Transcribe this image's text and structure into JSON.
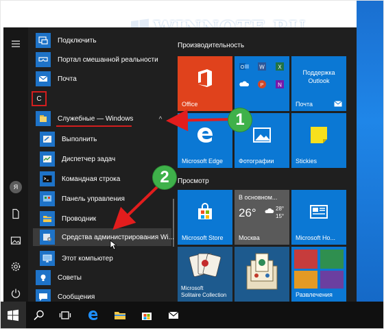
{
  "watermark": {
    "text": "WINNOTE.RU"
  },
  "rail": {
    "icons": [
      "hamburger-icon",
      "user-icon",
      "document-icon",
      "pictures-icon",
      "settings-icon",
      "power-icon"
    ],
    "avatar_letter": "Я"
  },
  "app_list": {
    "items": [
      {
        "label": "Подключить",
        "icon": "connect-icon"
      },
      {
        "label": "Портал смешанной реальности",
        "icon": "mixed-reality-icon"
      },
      {
        "label": "Почта",
        "icon": "mail-icon"
      },
      {
        "label": "Служебные — Windows",
        "icon": "folder-icon"
      },
      {
        "label": "Выполнить",
        "icon": "run-icon"
      },
      {
        "label": "Диспетчер задач",
        "icon": "task-manager-icon"
      },
      {
        "label": "Командная строка",
        "icon": "command-prompt-icon"
      },
      {
        "label": "Панель управления",
        "icon": "control-panel-icon"
      },
      {
        "label": "Проводник",
        "icon": "explorer-icon"
      },
      {
        "label": "Средства администрирования Wi...",
        "icon": "admin-tools-icon"
      },
      {
        "label": "Этот компьютер",
        "icon": "this-pc-icon"
      },
      {
        "label": "Советы",
        "icon": "tips-icon"
      },
      {
        "label": "Сообщения",
        "icon": "messaging-icon"
      }
    ],
    "letter_header": "С"
  },
  "tiles": {
    "section_productivity": "Производительность",
    "section_browse": "Просмотр",
    "office": {
      "label": "Office",
      "color": "#e0421c"
    },
    "office_group": {
      "apps": [
        "outlook-icon",
        "word-icon",
        "excel-icon",
        "onedrive-icon",
        "powerpoint-icon",
        "onenote-icon"
      ],
      "color": "#0b78d4"
    },
    "outlook_support": {
      "line1": "Поддержка",
      "line2": "Outlook",
      "label": "Почта",
      "color": "#0b78d4"
    },
    "edge": {
      "label": "Microsoft Edge",
      "color": "#0b78d4"
    },
    "photos": {
      "label": "Фотографии",
      "color": "#0b78d4"
    },
    "stickies": {
      "label": "Stickies",
      "color": "#0b78d4"
    },
    "store": {
      "label": "Microsoft Store",
      "color": "#0b78d4"
    },
    "weather": {
      "header": "В основном...",
      "temp_main": "26°",
      "temp_high": "28°",
      "temp_low": "15°",
      "label": "Москва",
      "color": "#5a5a5a"
    },
    "home": {
      "label": "Microsoft Ho...",
      "color": "#0b78d4"
    },
    "solitaire": {
      "line1": "Microsoft",
      "line2": "Solitaire Collection",
      "color": "#1d5a8e"
    },
    "mahjong": {
      "color": "#1d5a8e"
    },
    "entertainment": {
      "label": "Развлечения",
      "color": "#0b78d4"
    }
  },
  "annotations": {
    "step1": "1",
    "step2": "2",
    "arrow_color": "#e21d1d",
    "badge_color": "#3fb14a"
  },
  "taskbar": {
    "icons": [
      "windows-start-icon",
      "search-icon",
      "task-view-icon",
      "edge-icon",
      "file-explorer-icon",
      "store-icon",
      "mail-icon"
    ]
  }
}
